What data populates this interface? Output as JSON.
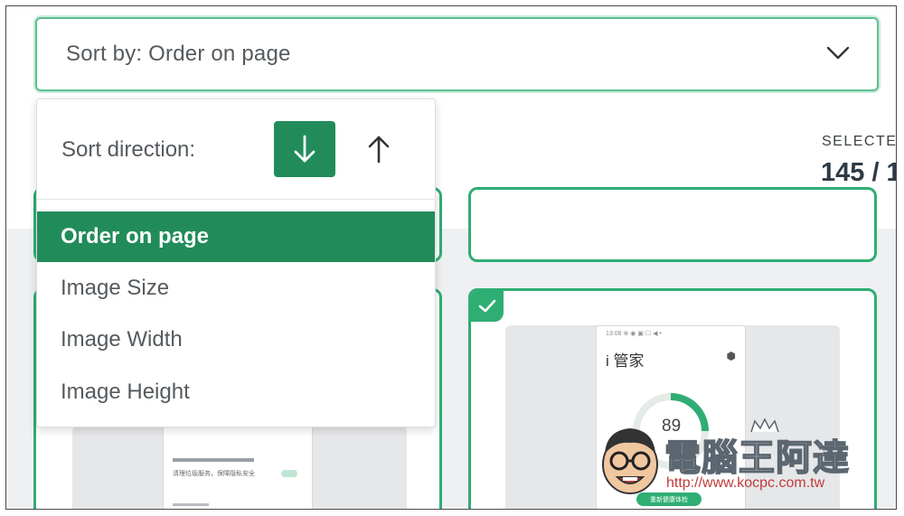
{
  "sort": {
    "select_label": "Sort by: Order on page",
    "direction_label": "Sort direction:",
    "options": [
      "Order on page",
      "Image Size",
      "Image Width",
      "Image Height"
    ],
    "selected_index": 0,
    "selected_direction": "down"
  },
  "selection": {
    "label": "SELECTE",
    "count": "145 / 1"
  },
  "gallery": {
    "cards": [
      {
        "checked": false
      },
      {
        "checked": false
      },
      {
        "checked": false
      },
      {
        "checked": true
      }
    ],
    "preview_phone": {
      "status": "13:08 ⊕ ◉ ▣ ☐ ◀ •",
      "title": "i 管家",
      "score": "89",
      "button": "重新健康体检"
    },
    "preview_row": "清理垃圾服务，保障隐私安全"
  },
  "watermark": {
    "text": "電腦王阿達",
    "url": "http://www.kocpc.com.tw"
  },
  "colors": {
    "accent": "#218c5a",
    "accent_light": "#2fae74",
    "focus_ring": "#5cbf91",
    "text": "#555a5e"
  },
  "icons": {
    "select": "chevron-down-icon",
    "descending": "arrow-down-icon",
    "ascending": "arrow-up-icon",
    "card_check": "check-icon"
  }
}
